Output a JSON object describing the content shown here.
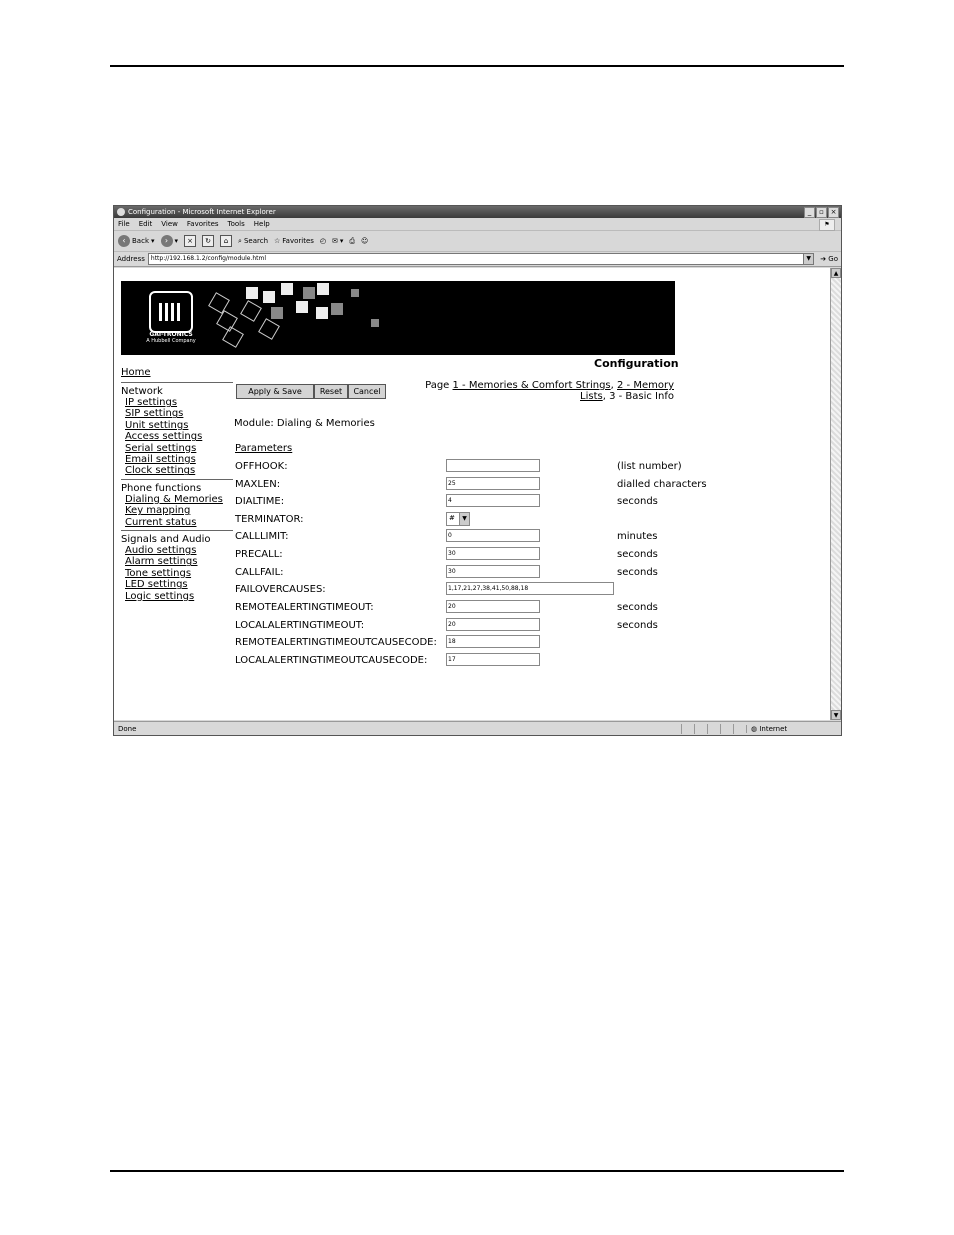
{
  "window": {
    "title": "Configuration - Microsoft Internet Explorer",
    "menu": [
      "File",
      "Edit",
      "View",
      "Favorites",
      "Tools",
      "Help"
    ],
    "toolbar": {
      "back": "Back",
      "search": "Search",
      "favorites": "Favorites"
    },
    "address_label": "Address",
    "address": "http://192.168.1.2/config/module.html",
    "go": "Go",
    "status": "Done",
    "zone": "Internet"
  },
  "brand": {
    "name": "GAI-TRONICS",
    "tagline": "A Hubbell Company"
  },
  "page": {
    "title": "Configuration",
    "page_prefix": "Page",
    "page_link1": "1 - Memories & Comfort Strings",
    "page_link2a": "2 - Memory",
    "page_link2b": "Lists",
    "page_current": "3 - Basic Info",
    "module": "Module: Dialing & Memories",
    "parameters": "Parameters"
  },
  "nav": {
    "home": "Home",
    "network": "Network",
    "network_items": [
      "IP settings",
      "SIP settings",
      "Unit settings",
      "Access settings",
      "Serial settings",
      "Email settings",
      "Clock settings"
    ],
    "phone": "Phone functions",
    "phone_items": [
      "Dialing & Memories",
      "Key mapping",
      "Current status"
    ],
    "signals": "Signals and Audio",
    "signals_items": [
      "Audio settings",
      "Alarm settings",
      "Tone settings",
      "LED settings",
      "Logic settings"
    ]
  },
  "buttons": {
    "apply": "Apply & Save",
    "reset": "Reset",
    "cancel": "Cancel"
  },
  "fields": [
    {
      "label": "OFFHOOK:",
      "value": "",
      "unit": "(list number)"
    },
    {
      "label": "MAXLEN:",
      "value": "25",
      "unit": "dialled characters"
    },
    {
      "label": "DIALTIME:",
      "value": "4",
      "unit": "seconds"
    },
    {
      "label": "TERMINATOR:",
      "value": "#",
      "unit": ""
    },
    {
      "label": "CALLLIMIT:",
      "value": "0",
      "unit": "minutes"
    },
    {
      "label": "PRECALL:",
      "value": "30",
      "unit": "seconds"
    },
    {
      "label": "CALLFAIL:",
      "value": "30",
      "unit": "seconds"
    },
    {
      "label": "FAILOVERCAUSES:",
      "value": "1,17,21,27,38,41,50,88,18",
      "unit": ""
    },
    {
      "label": "REMOTEALERTINGTIMEOUT:",
      "value": "20",
      "unit": "seconds"
    },
    {
      "label": "LOCALALERTINGTIMEOUT:",
      "value": "20",
      "unit": "seconds"
    },
    {
      "label": "REMOTEALERTINGTIMEOUTCAUSECODE:",
      "value": "18",
      "unit": ""
    },
    {
      "label": "LOCALALERTINGTIMEOUTCAUSECODE:",
      "value": "17",
      "unit": ""
    }
  ]
}
